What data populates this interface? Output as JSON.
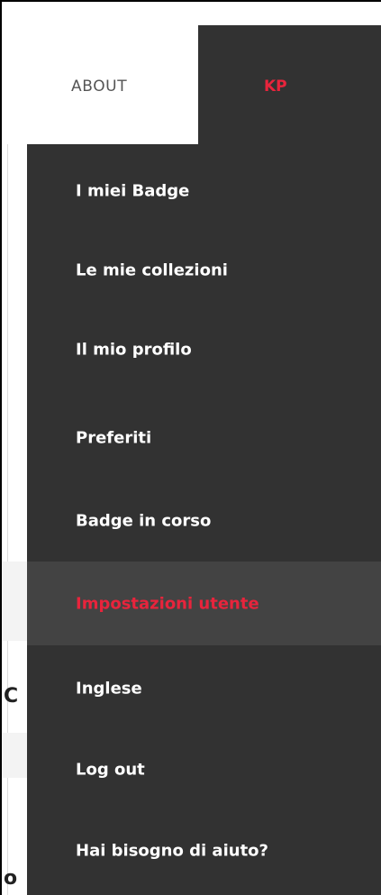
{
  "nav": {
    "about_label": "ABOUT",
    "user_initials": "KP"
  },
  "dropdown": {
    "items": [
      {
        "label": "I miei Badge",
        "active": false
      },
      {
        "label": "Le mie collezioni",
        "active": false
      },
      {
        "label": "Il mio profilo",
        "active": false
      },
      {
        "label": "Preferiti",
        "active": false
      },
      {
        "label": "Badge in corso",
        "active": false
      },
      {
        "label": "Impostazioni utente",
        "active": true
      },
      {
        "label": "Inglese",
        "active": false
      },
      {
        "label": "Log out",
        "active": false
      },
      {
        "label": "Hai bisogno di aiuto?",
        "active": false
      }
    ]
  },
  "background_peek": {
    "text_1": "C",
    "text_2": "o"
  },
  "colors": {
    "menu_bg": "#323232",
    "menu_active_bg": "#434343",
    "accent": "#e8243c",
    "menu_text": "#ffffff",
    "about_text": "#555555"
  }
}
